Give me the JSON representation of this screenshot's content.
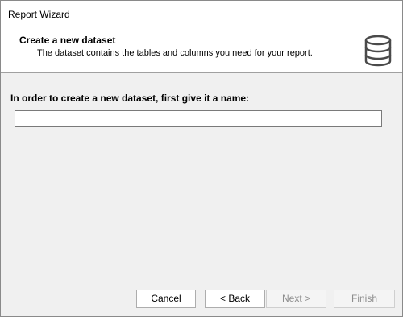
{
  "window": {
    "title": "Report Wizard"
  },
  "header": {
    "title": "Create a new dataset",
    "subtitle": "The dataset contains the tables and columns you need for your report."
  },
  "main": {
    "prompt": "In order to create a new dataset, first give it a name:",
    "name_value": "",
    "name_placeholder": ""
  },
  "footer": {
    "cancel_label": "Cancel",
    "back_label": "< Back",
    "next_label": "Next >",
    "finish_label": "Finish",
    "next_enabled": false,
    "finish_enabled": false
  },
  "colors": {
    "window_bg": "#f0f0f0",
    "header_bg": "#ffffff",
    "disabled_text": "#8d8d8d",
    "icon_dark": "#4a4a4a"
  },
  "icons": {
    "header_icon": "database-icon"
  }
}
